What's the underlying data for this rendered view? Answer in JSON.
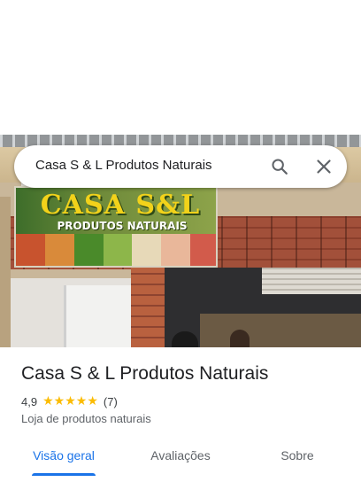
{
  "search": {
    "query": "Casa S & L Produtos Naturais"
  },
  "photo": {
    "sign_title": "CASA S&L",
    "sign_subtitle": "PRODUTOS NATURAIS",
    "product_colors": [
      "#c8532e",
      "#d98a3a",
      "#4a8a2a",
      "#8db64a",
      "#e7d9b8",
      "#e9b79a",
      "#d25b4b"
    ]
  },
  "place": {
    "name": "Casa S & L Produtos Naturais",
    "rating": "4,9",
    "stars": 5,
    "review_count": "(7)",
    "category": "Loja de produtos naturais"
  },
  "tabs": [
    {
      "label": "Visão geral",
      "active": true
    },
    {
      "label": "Avaliações",
      "active": false
    },
    {
      "label": "Sobre",
      "active": false
    }
  ],
  "colors": {
    "accent": "#1a73e8",
    "star": "#fbbc04",
    "text_primary": "#202124",
    "text_secondary": "#5f6368"
  },
  "icons": {
    "search": "search-icon",
    "close": "close-icon",
    "star": "star-icon"
  }
}
